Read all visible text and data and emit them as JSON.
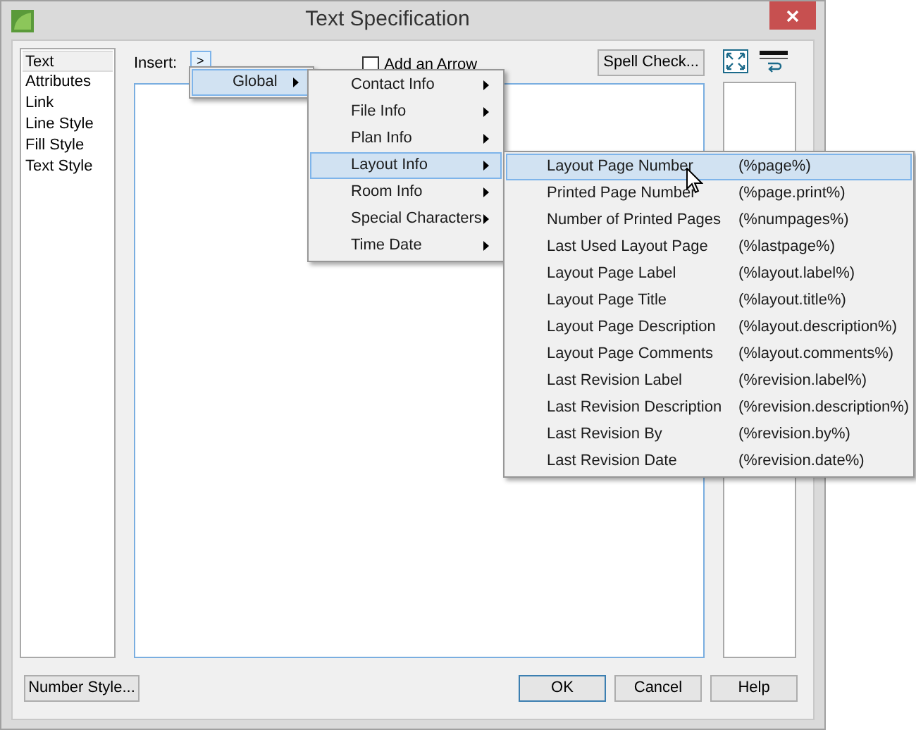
{
  "window": {
    "title": "Text Specification"
  },
  "sidebar": {
    "items": [
      {
        "label": "Text",
        "selected": true
      },
      {
        "label": "Attributes",
        "selected": false
      },
      {
        "label": "Link",
        "selected": false
      },
      {
        "label": "Line Style",
        "selected": false
      },
      {
        "label": "Fill Style",
        "selected": false
      },
      {
        "label": "Text Style",
        "selected": false
      }
    ]
  },
  "insert": {
    "label": "Insert:",
    "button": ">"
  },
  "add_arrow": {
    "label": "Add an Arrow",
    "checked": false
  },
  "spell_check": "Spell Check...",
  "menus": [
    {
      "items": [
        {
          "label": "Global",
          "selected": true,
          "submenu": true
        }
      ]
    },
    {
      "items": [
        {
          "label": "Contact Info",
          "selected": false,
          "submenu": true
        },
        {
          "label": "File Info",
          "selected": false,
          "submenu": true
        },
        {
          "label": "Plan Info",
          "selected": false,
          "submenu": true
        },
        {
          "label": "Layout Info",
          "selected": true,
          "submenu": true
        },
        {
          "label": "Room Info",
          "selected": false,
          "submenu": true
        },
        {
          "label": "Special Characters",
          "selected": false,
          "submenu": true
        },
        {
          "label": "Time  Date",
          "selected": false,
          "submenu": true
        }
      ]
    },
    {
      "items": [
        {
          "label": "Layout Page Number",
          "shortcut": "(%page%)",
          "selected": true
        },
        {
          "label": "Printed Page Number",
          "shortcut": "(%page.print%)",
          "selected": false
        },
        {
          "label": "Number of Printed Pages",
          "shortcut": "(%numpages%)",
          "selected": false
        },
        {
          "label": "Last Used Layout Page",
          "shortcut": "(%lastpage%)",
          "selected": false
        },
        {
          "label": "Layout Page Label",
          "shortcut": "(%layout.label%)",
          "selected": false
        },
        {
          "label": "Layout Page Title",
          "shortcut": "(%layout.title%)",
          "selected": false
        },
        {
          "label": "Layout Page Description",
          "shortcut": "(%layout.description%)",
          "selected": false
        },
        {
          "label": "Layout Page Comments",
          "shortcut": "(%layout.comments%)",
          "selected": false
        },
        {
          "label": "Last Revision Label",
          "shortcut": "(%revision.label%)",
          "selected": false
        },
        {
          "label": "Last Revision Description",
          "shortcut": "(%revision.description%)",
          "selected": false
        },
        {
          "label": "Last Revision By",
          "shortcut": "(%revision.by%)",
          "selected": false
        },
        {
          "label": "Last Revision Date",
          "shortcut": "(%revision.date%)",
          "selected": false
        }
      ]
    }
  ],
  "number_style": "Number Style...",
  "buttons": [
    {
      "label": "OK",
      "selected": true
    },
    {
      "label": "Cancel",
      "selected": false
    },
    {
      "label": "Help",
      "selected": false
    }
  ]
}
